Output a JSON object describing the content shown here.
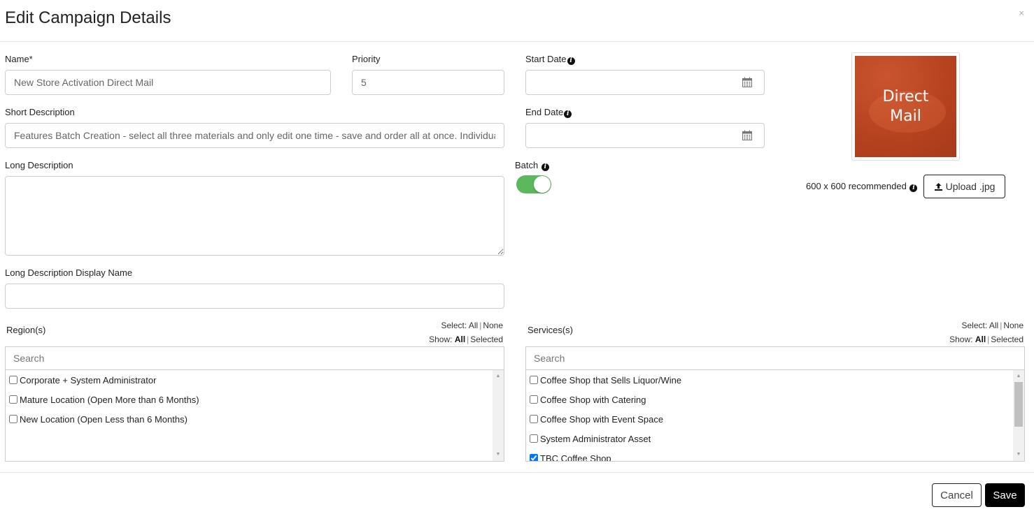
{
  "modal": {
    "title": "Edit Campaign Details",
    "close_label": "×"
  },
  "form": {
    "name": {
      "label": "Name*",
      "value": "New Store Activation Direct Mail"
    },
    "priority": {
      "label": "Priority",
      "value": "5"
    },
    "start_date": {
      "label": "Start Date",
      "value": ""
    },
    "end_date": {
      "label": "End Date",
      "value": ""
    },
    "short_description": {
      "label": "Short Description",
      "value": "Features Batch Creation - select all three materials and only edit one time - save and order all at once. Individual"
    },
    "long_description": {
      "label": "Long Description",
      "value": ""
    },
    "long_description_display_name": {
      "label": "Long Description Display Name",
      "value": ""
    },
    "batch": {
      "label": "Batch",
      "on": true
    }
  },
  "image": {
    "text_line1": "Direct",
    "text_line2": "Mail",
    "recommend": "600 x 600 recommended",
    "upload_label": "Upload .jpg"
  },
  "select_controls": {
    "select_label": "Select:",
    "all": "All",
    "none": "None",
    "show_label": "Show:",
    "show_all": "All",
    "selected": "Selected"
  },
  "regions": {
    "label": "Region(s)",
    "search_placeholder": "Search",
    "items": [
      {
        "label": "Corporate + System Administrator",
        "checked": false
      },
      {
        "label": "Mature Location (Open More than 6 Months)",
        "checked": false
      },
      {
        "label": "New Location (Open Less than 6 Months)",
        "checked": false
      }
    ]
  },
  "services": {
    "label": "Services(s)",
    "search_placeholder": "Search",
    "items": [
      {
        "label": "Coffee Shop that Sells Liquor/Wine",
        "checked": false
      },
      {
        "label": "Coffee Shop with Catering",
        "checked": false
      },
      {
        "label": "Coffee Shop with Event Space",
        "checked": false
      },
      {
        "label": "System Administrator Asset",
        "checked": false
      },
      {
        "label": "TBC Coffee Shop",
        "checked": true
      }
    ]
  },
  "footer": {
    "cancel_label": "Cancel",
    "save_label": "Save"
  },
  "colors": {
    "toggle_on": "#5cb85c",
    "thumb_bg": "#b5421f",
    "save_bg": "#000000"
  }
}
